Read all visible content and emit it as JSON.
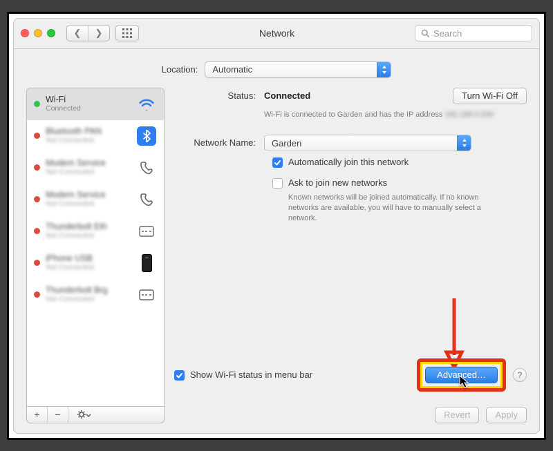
{
  "titlebar": {
    "title": "Network",
    "search_placeholder": "Search"
  },
  "location": {
    "label": "Location:",
    "value": "Automatic"
  },
  "sidebar": {
    "items": [
      {
        "name": "Wi-Fi",
        "sub": "Connected",
        "status": "on",
        "icon": "wifi"
      },
      {
        "name": "—",
        "sub": "—",
        "status": "off",
        "icon": "bluetooth"
      },
      {
        "name": "—",
        "sub": "—",
        "status": "off",
        "icon": "phone"
      },
      {
        "name": "—",
        "sub": "—",
        "status": "off",
        "icon": "phone"
      },
      {
        "name": "—",
        "sub": "—",
        "status": "off",
        "icon": "ethernet"
      },
      {
        "name": "—",
        "sub": "—",
        "status": "off",
        "icon": "iphone"
      },
      {
        "name": "—",
        "sub": "—",
        "status": "off",
        "icon": "ethernet"
      }
    ]
  },
  "panel": {
    "status_label": "Status:",
    "status_value": "Connected",
    "wifi_toggle": "Turn Wi-Fi Off",
    "status_detail_prefix": "Wi-Fi is connected to Garden and has the IP address",
    "network_label": "Network Name:",
    "network_value": "Garden",
    "auto_join": "Automatically join this network",
    "ask_join": "Ask to join new networks",
    "ask_join_detail": "Known networks will be joined automatically. If no known networks are available, you will have to manually select a network.",
    "show_status": "Show Wi-Fi status in menu bar",
    "advanced": "Advanced…",
    "revert": "Revert",
    "apply": "Apply",
    "help": "?"
  },
  "colors": {
    "accent": "#2f7ef0",
    "highlight_border": "#e53017",
    "highlight_fill": "#ffd400"
  }
}
